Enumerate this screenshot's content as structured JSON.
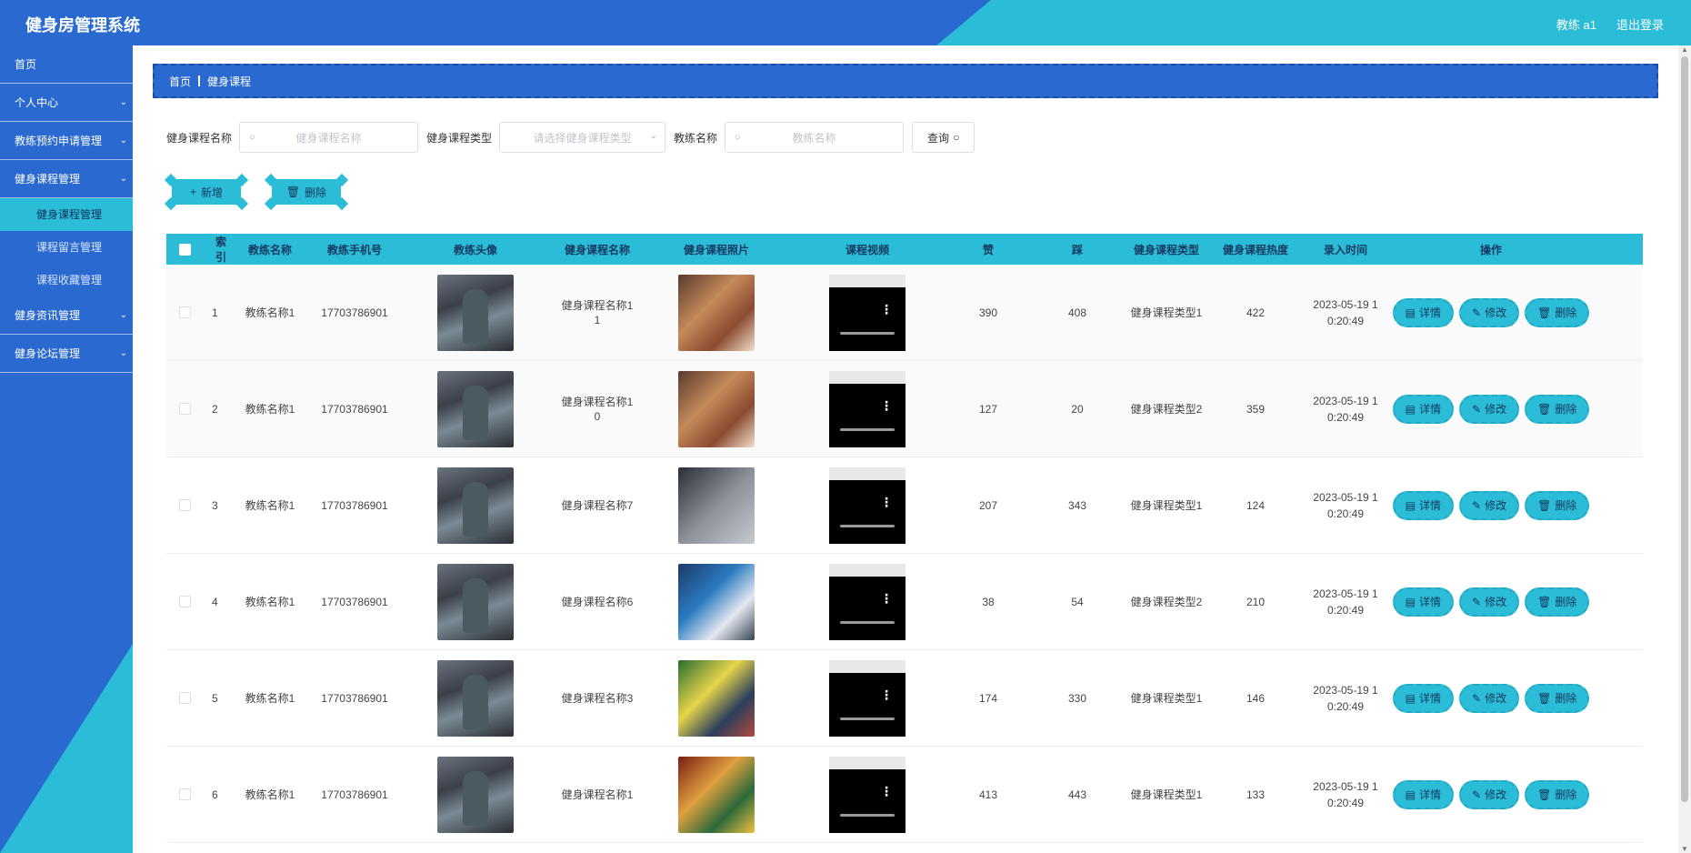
{
  "header": {
    "title": "健身房管理系统",
    "user": "教练 a1",
    "logout": "退出登录"
  },
  "sidebar": {
    "items": [
      {
        "label": "首页",
        "arrow": ""
      },
      {
        "label": "个人中心",
        "arrow": "⌄"
      },
      {
        "label": "教练预约申请管理",
        "arrow": "⌄"
      },
      {
        "label": "健身课程管理",
        "arrow": "⌄"
      },
      {
        "label": "健身课程管理",
        "sub": true,
        "active": true
      },
      {
        "label": "课程留言管理",
        "sub": true
      },
      {
        "label": "课程收藏管理",
        "sub": true
      },
      {
        "label": "健身资讯管理",
        "arrow": "⌄"
      },
      {
        "label": "健身论坛管理",
        "arrow": "⌄"
      }
    ]
  },
  "breadcrumb": {
    "home": "首页",
    "current": "健身课程"
  },
  "search": {
    "course_label": "健身课程名称",
    "course_placeholder": "健身课程名称",
    "type_label": "健身课程类型",
    "type_placeholder": "请选择健身课程类型",
    "coach_label": "教练名称",
    "coach_placeholder": "教练名称",
    "query_button": "查询"
  },
  "actions": {
    "add": "新增",
    "delete": "删除"
  },
  "table": {
    "headers": [
      "索引",
      "教练名称",
      "教练手机号",
      "教练头像",
      "健身课程名称",
      "健身课程照片",
      "课程视频",
      "赞",
      "踩",
      "健身课程类型",
      "健身课程热度",
      "录入时间",
      "操作"
    ],
    "ops": {
      "detail": "详情",
      "edit": "修改",
      "delete": "删除"
    },
    "rows": [
      {
        "index": "1",
        "coach": "教练名称1",
        "phone": "17703786901",
        "course_l1": "健身课程名称1",
        "course_l2": "1",
        "photo": "p1",
        "like": "390",
        "dislike": "408",
        "type": "健身课程类型1",
        "heat": "422",
        "time_l1": "2023-05-19 1",
        "time_l2": "0:20:49"
      },
      {
        "index": "2",
        "coach": "教练名称1",
        "phone": "17703786901",
        "course_l1": "健身课程名称1",
        "course_l2": "0",
        "photo": "p1",
        "like": "127",
        "dislike": "20",
        "type": "健身课程类型2",
        "heat": "359",
        "time_l1": "2023-05-19 1",
        "time_l2": "0:20:49"
      },
      {
        "index": "3",
        "coach": "教练名称1",
        "phone": "17703786901",
        "course_l1": "健身课程名称7",
        "course_l2": "",
        "photo": "p2",
        "like": "207",
        "dislike": "343",
        "type": "健身课程类型1",
        "heat": "124",
        "time_l1": "2023-05-19 1",
        "time_l2": "0:20:49"
      },
      {
        "index": "4",
        "coach": "教练名称1",
        "phone": "17703786901",
        "course_l1": "健身课程名称6",
        "course_l2": "",
        "photo": "p3",
        "like": "38",
        "dislike": "54",
        "type": "健身课程类型2",
        "heat": "210",
        "time_l1": "2023-05-19 1",
        "time_l2": "0:20:49"
      },
      {
        "index": "5",
        "coach": "教练名称1",
        "phone": "17703786901",
        "course_l1": "健身课程名称3",
        "course_l2": "",
        "photo": "p4",
        "like": "174",
        "dislike": "330",
        "type": "健身课程类型1",
        "heat": "146",
        "time_l1": "2023-05-19 1",
        "time_l2": "0:20:49"
      },
      {
        "index": "6",
        "coach": "教练名称1",
        "phone": "17703786901",
        "course_l1": "健身课程名称1",
        "course_l2": "",
        "photo": "p5",
        "like": "413",
        "dislike": "443",
        "type": "健身课程类型1",
        "heat": "133",
        "time_l1": "2023-05-19 1",
        "time_l2": "0:20:49"
      }
    ]
  },
  "colors": {
    "primary": "#2a6ad0",
    "accent": "#2bbcd8"
  }
}
